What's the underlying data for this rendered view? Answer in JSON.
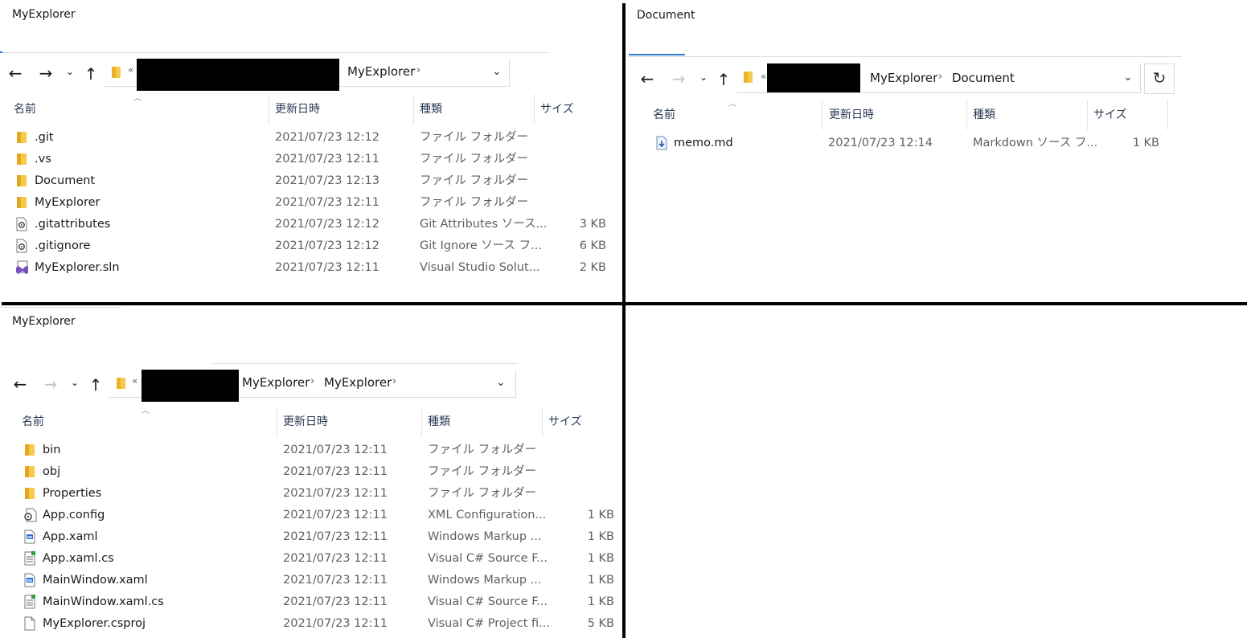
{
  "columns": {
    "name": "名前",
    "date": "更新日時",
    "type": "種類",
    "size": "サイズ"
  },
  "ui_symbols": {
    "back": "←",
    "forward": "→",
    "history": "⌄",
    "up": "↑",
    "overflow": "«",
    "chevron": "›",
    "dropdown": "⌄",
    "refresh": "↻"
  },
  "pane_top_left": {
    "title": "MyExplorer",
    "breadcrumb": [
      "MyExplorer"
    ],
    "rows": [
      {
        "icon": "folder-icon",
        "name": ".git",
        "date": "2021/07/23 12:12",
        "type": "ファイル フォルダー",
        "size": ""
      },
      {
        "icon": "folder-icon",
        "name": ".vs",
        "date": "2021/07/23 12:11",
        "type": "ファイル フォルダー",
        "size": ""
      },
      {
        "icon": "folder-icon",
        "name": "Document",
        "date": "2021/07/23 12:13",
        "type": "ファイル フォルダー",
        "size": ""
      },
      {
        "icon": "folder-icon",
        "name": "MyExplorer",
        "date": "2021/07/23 12:11",
        "type": "ファイル フォルダー",
        "size": ""
      },
      {
        "icon": "settings-file-icon",
        "name": ".gitattributes",
        "date": "2021/07/23 12:12",
        "type": "Git Attributes ソース...",
        "size": "3 KB"
      },
      {
        "icon": "settings-file-icon",
        "name": ".gitignore",
        "date": "2021/07/23 12:12",
        "type": "Git Ignore ソース フ...",
        "size": "6 KB"
      },
      {
        "icon": "solution-file-icon",
        "name": "MyExplorer.sln",
        "date": "2021/07/23 12:11",
        "type": "Visual Studio Solut...",
        "size": "2 KB"
      }
    ]
  },
  "pane_top_right": {
    "title": "Document",
    "breadcrumb": [
      "MyExplorer",
      "Document"
    ],
    "rows": [
      {
        "icon": "markdown-file-icon",
        "name": "memo.md",
        "date": "2021/07/23 12:14",
        "type": "Markdown ソース フ...",
        "size": "1 KB"
      }
    ]
  },
  "pane_bottom_left": {
    "title": "MyExplorer",
    "breadcrumb": [
      "MyExplorer",
      "MyExplorer"
    ],
    "rows": [
      {
        "icon": "folder-icon",
        "name": "bin",
        "date": "2021/07/23 12:11",
        "type": "ファイル フォルダー",
        "size": ""
      },
      {
        "icon": "folder-icon",
        "name": "obj",
        "date": "2021/07/23 12:11",
        "type": "ファイル フォルダー",
        "size": ""
      },
      {
        "icon": "folder-icon",
        "name": "Properties",
        "date": "2021/07/23 12:11",
        "type": "ファイル フォルダー",
        "size": ""
      },
      {
        "icon": "config-file-icon",
        "name": "App.config",
        "date": "2021/07/23 12:11",
        "type": "XML Configuration...",
        "size": "1 KB"
      },
      {
        "icon": "xaml-file-icon",
        "name": "App.xaml",
        "date": "2021/07/23 12:11",
        "type": "Windows Markup ...",
        "size": "1 KB"
      },
      {
        "icon": "csharp-file-icon",
        "name": "App.xaml.cs",
        "date": "2021/07/23 12:11",
        "type": "Visual C# Source F...",
        "size": "1 KB"
      },
      {
        "icon": "xaml-file-icon",
        "name": "MainWindow.xaml",
        "date": "2021/07/23 12:11",
        "type": "Windows Markup ...",
        "size": "1 KB"
      },
      {
        "icon": "csharp-file-icon",
        "name": "MainWindow.xaml.cs",
        "date": "2021/07/23 12:11",
        "type": "Visual C# Source F...",
        "size": "1 KB"
      },
      {
        "icon": "blank-file-icon",
        "name": "MyExplorer.csproj",
        "date": "2021/07/23 12:11",
        "type": "Visual C# Project fi...",
        "size": "5 KB"
      }
    ]
  }
}
